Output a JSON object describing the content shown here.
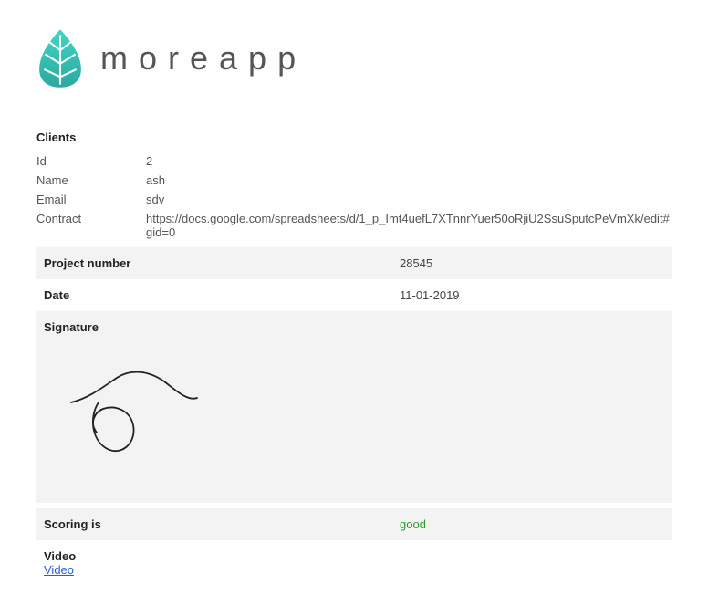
{
  "brand": {
    "name": "moreapp"
  },
  "clients": {
    "title": "Clients",
    "rows": {
      "id": {
        "label": "Id",
        "value": "2"
      },
      "name": {
        "label": "Name",
        "value": "ash"
      },
      "email": {
        "label": "Email",
        "value": "sdv"
      },
      "contract": {
        "label": "Contract",
        "value": "https://docs.google.com/spreadsheets/d/1_p_Imt4uefL7XTnnrYuer50oRjiU2SsuSputcPeVmXk/edit#gid=0"
      }
    }
  },
  "project_number": {
    "label": "Project number",
    "value": "28545"
  },
  "date": {
    "label": "Date",
    "value": "11-01-2019"
  },
  "signature": {
    "label": "Signature"
  },
  "scoring": {
    "label": "Scoring is",
    "value": "good"
  },
  "video": {
    "label": "Video",
    "link_text": "Video"
  }
}
